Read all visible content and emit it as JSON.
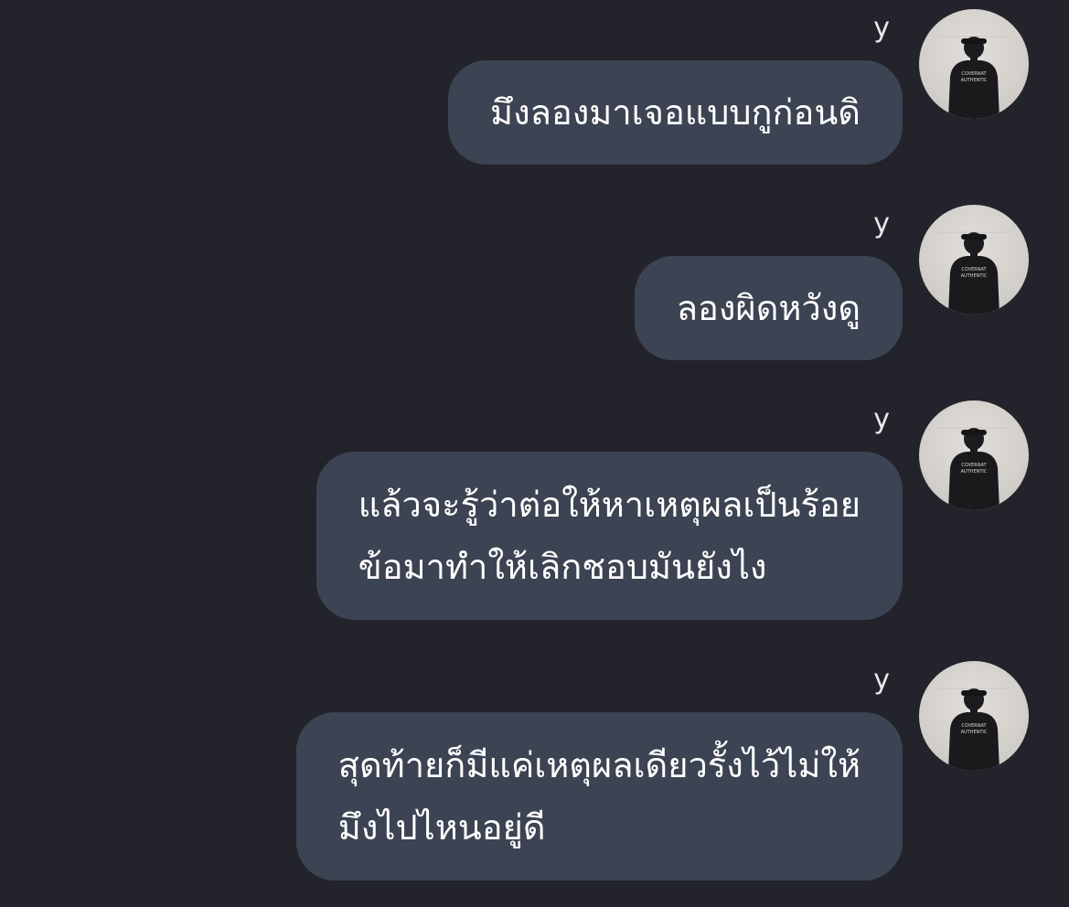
{
  "messages": [
    {
      "sender": "y",
      "lines": [
        "มึงลองมาเจอแบบกูก่อนดิ"
      ],
      "avatar_icon": "person-back-shirt-icon"
    },
    {
      "sender": "y",
      "lines": [
        "ลองผิดหวังดู"
      ],
      "avatar_icon": "person-back-shirt-icon"
    },
    {
      "sender": "y",
      "lines": [
        "แล้วจะรู้ว่าต่อให้หาเหตุผลเป็นร้อย",
        "ข้อมาทำให้เลิกชอบมันยังไง"
      ],
      "avatar_icon": "person-back-shirt-icon"
    },
    {
      "sender": "y",
      "lines": [
        "สุดท้ายก็มีแค่เหตุผลเดียวรั้งไว้ไม่ให้",
        "มึงไปไหนอยู่ดี"
      ],
      "avatar_icon": "person-back-shirt-icon"
    }
  ],
  "avatar_shirt_text": [
    "COVERNAT",
    "AUTHENTIC"
  ],
  "colors": {
    "background": "#23242b",
    "bubble": "#3c4352",
    "text": "#ffffff",
    "sender": "#e6e8ec"
  }
}
